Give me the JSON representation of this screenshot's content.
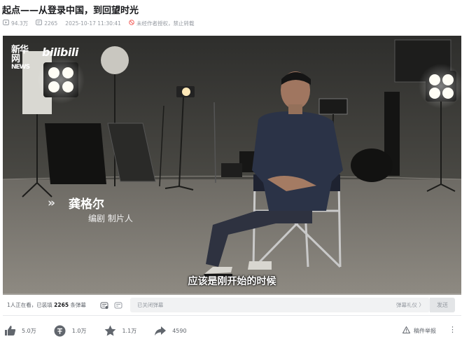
{
  "video": {
    "title": "起点——从登录中国，到回望时光",
    "views": "94.3万",
    "danmaku_count": "2265",
    "publish_time": "2025-10-17 11:30:41",
    "notice": "未经作者授权，禁止转载"
  },
  "player": {
    "logo_news_top": "新华网",
    "logo_news_bottom": "NEWS",
    "logo_bili": "bilibili",
    "name_card": {
      "chevrons": "»",
      "name": "龚格尔",
      "role": "编剧 制片人"
    },
    "subtitle": "应该是刚开始的时候",
    "progress": 0.0
  },
  "danmaku_bar": {
    "watching": "1人正在看，已装填",
    "loaded_count": "2265",
    "loaded_suffix": "条弹幕",
    "input_placeholder": "已关闭弹幕",
    "etiquette": "弹幕礼仪 〉",
    "send": "发送"
  },
  "toolbar": {
    "like": "5.0万",
    "coin": "1.0万",
    "favorite": "1.1万",
    "share": "4590",
    "report": "稿件举报",
    "more": "⋮"
  },
  "icons": {
    "views": "play-count-icon",
    "danmaku": "danmaku-count-icon",
    "notice": "no-repost-icon",
    "danmaku_toggle": "danmaku-toggle-icon",
    "danmaku_settings": "danmaku-settings-icon",
    "like": "thumbs-up-icon",
    "coin": "coin-icon",
    "favorite": "star-icon",
    "share": "share-arrow-icon",
    "report": "warning-icon"
  },
  "colors": {
    "accent": "#3d9bd9",
    "notice_red": "#f25d59",
    "muted": "#9499a0",
    "text": "#18191c"
  }
}
